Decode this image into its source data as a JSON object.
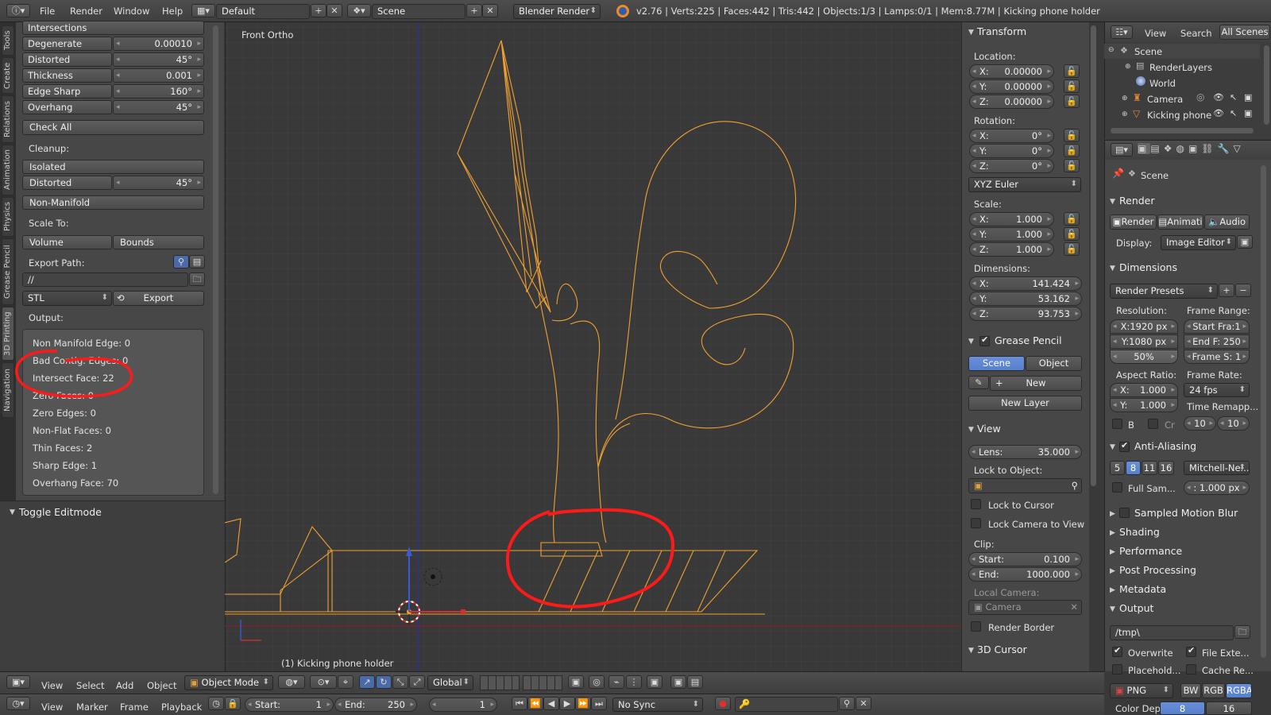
{
  "topbar": {
    "menus": [
      "File",
      "Render",
      "Window",
      "Help"
    ],
    "layout": "Default",
    "scene": "Scene",
    "engine": "Blender Render",
    "stats": "v2.76 | Verts:225 | Faces:442 | Tris:442 | Objects:1/3 | Lamps:0/1 | Mem:8.77M | Kicking phone holder"
  },
  "sidetabs": [
    "Tools",
    "Create",
    "Relations",
    "Animation",
    "Physics",
    "Grease Pencil",
    "3D Printing",
    "Navigation"
  ],
  "toolpanel": {
    "header": "Intersections",
    "rows": [
      {
        "label": "Degenerate",
        "value": "0.00010"
      },
      {
        "label": "Distorted",
        "value": "45°"
      },
      {
        "label": "Thickness",
        "value": "0.001"
      },
      {
        "label": "Edge Sharp",
        "value": "160°"
      },
      {
        "label": "Overhang",
        "value": "45°"
      }
    ],
    "check_all": "Check All",
    "cleanup": "Cleanup:",
    "isolated": "Isolated",
    "distorted": "Distorted",
    "distorted_val": "45°",
    "non_manifold": "Non-Manifold",
    "scale_to": "Scale To:",
    "volume": "Volume",
    "bounds": "Bounds",
    "export_path": "Export Path:",
    "path": "//",
    "format": "STL",
    "export": "Export",
    "output": "Output:",
    "results": [
      "Non Manifold Edge: 0",
      "Bad Contig. Edges: 0",
      "Intersect Face: 22",
      "Zero Faces: 0",
      "Zero Edges: 0",
      "Non-Flat Faces: 0",
      "Thin Faces: 2",
      "Sharp Edge: 1",
      "Overhang Face: 70"
    ],
    "toggle": "Toggle Editmode"
  },
  "viewport": {
    "view_name": "Front Ortho",
    "object_label": "(1) Kicking phone holder"
  },
  "npanel": {
    "transform": "Transform",
    "location": "Location:",
    "loc": [
      {
        "k": "X:",
        "v": "0.00000"
      },
      {
        "k": "Y:",
        "v": "0.00000"
      },
      {
        "k": "Z:",
        "v": "0.00000"
      }
    ],
    "rotation": "Rotation:",
    "rot": [
      {
        "k": "X:",
        "v": "0°"
      },
      {
        "k": "Y:",
        "v": "0°"
      },
      {
        "k": "Z:",
        "v": "0°"
      }
    ],
    "euler": "XYZ Euler",
    "scale": "Scale:",
    "scl": [
      {
        "k": "X:",
        "v": "1.000"
      },
      {
        "k": "Y:",
        "v": "1.000"
      },
      {
        "k": "Z:",
        "v": "1.000"
      }
    ],
    "dimensions": "Dimensions:",
    "dim": [
      {
        "k": "X:",
        "v": "141.424"
      },
      {
        "k": "Y:",
        "v": "53.162"
      },
      {
        "k": "Z:",
        "v": "93.753"
      }
    ],
    "grease": "Grease Pencil",
    "gp_scene": "Scene",
    "gp_object": "Object",
    "gp_new": "New",
    "gp_newlayer": "New Layer",
    "view": "View",
    "lens_k": "Lens:",
    "lens_v": "35.000",
    "lock_obj": "Lock to Object:",
    "lock_cursor": "Lock to Cursor",
    "lock_cam": "Lock Camera to View",
    "clip": "Clip:",
    "clip_start_k": "Start:",
    "clip_start_v": "0.100",
    "clip_end_k": "End:",
    "clip_end_v": "1000.000",
    "local_cam": "Local Camera:",
    "camera": "Camera",
    "render_border": "Render Border",
    "cursor3d": "3D Cursor"
  },
  "outliner": {
    "view": "View",
    "search": "Search",
    "all_scenes": "All Scenes",
    "items": [
      "Scene",
      "RenderLayers",
      "World",
      "Camera",
      "Kicking phone"
    ]
  },
  "props": {
    "scene": "Scene",
    "render": "Render",
    "render_btn": "Render",
    "anim_btn": "Animati",
    "audio_btn": "Audio",
    "display_k": "Display:",
    "display_v": "Image Editor",
    "dimensions": "Dimensions",
    "presets": "Render Presets",
    "resolution": "Resolution:",
    "res_x": "X:1920 px",
    "res_y": "Y:1080 px",
    "res_pct": "50%",
    "frame_range": "Frame Range:",
    "start_fra": "Start Fra:1",
    "end_f": "End F: 250",
    "frame_s": "Frame S: 1",
    "aspect": "Aspect Ratio:",
    "asp_x_k": "X:",
    "asp_x_v": "1.000",
    "asp_y_k": "Y:",
    "asp_y_v": "1.000",
    "frame_rate": "Frame Rate:",
    "fps": "24 fps",
    "time_remap": "Time Remapp...",
    "b": "B",
    "cr": "Cr",
    "remap_a": "10",
    "remap_b": "10",
    "aa": "Anti-Aliasing",
    "aa_vals": [
      "5",
      "8",
      "11",
      "16"
    ],
    "filter": "Mitchell-Ne...",
    "full_sam": "Full Sam...",
    "px": ": 1.000 px",
    "sampled_mb": "Sampled Motion Blur",
    "shading": "Shading",
    "performance": "Performance",
    "post_processing": "Post Processing",
    "metadata": "Metadata",
    "output": "Output",
    "out_path": "/tmp\\",
    "overwrite": "Overwrite",
    "file_ext": "File Exte...",
    "placeholders": "Placehold...",
    "cache": "Cache Re...",
    "fmt": "PNG",
    "bw": "BW",
    "rgb": "RGB",
    "rgba": "RGBA",
    "color_dep": "Color Dep",
    "dep8": "8",
    "dep16": "16"
  },
  "header3d": {
    "view": "View",
    "select": "Select",
    "add": "Add",
    "object": "Object",
    "mode": "Object Mode",
    "orientation": "Global"
  },
  "timeline": {
    "view": "View",
    "marker": "Marker",
    "frame": "Frame",
    "playback": "Playback",
    "start_k": "Start:",
    "start_v": "1",
    "end_k": "End:",
    "end_v": "250",
    "current": "1",
    "sync": "No Sync"
  },
  "colors": {
    "accent": "#5680cf",
    "wire": "#f0a030",
    "annotation": "#ff1a1a"
  }
}
